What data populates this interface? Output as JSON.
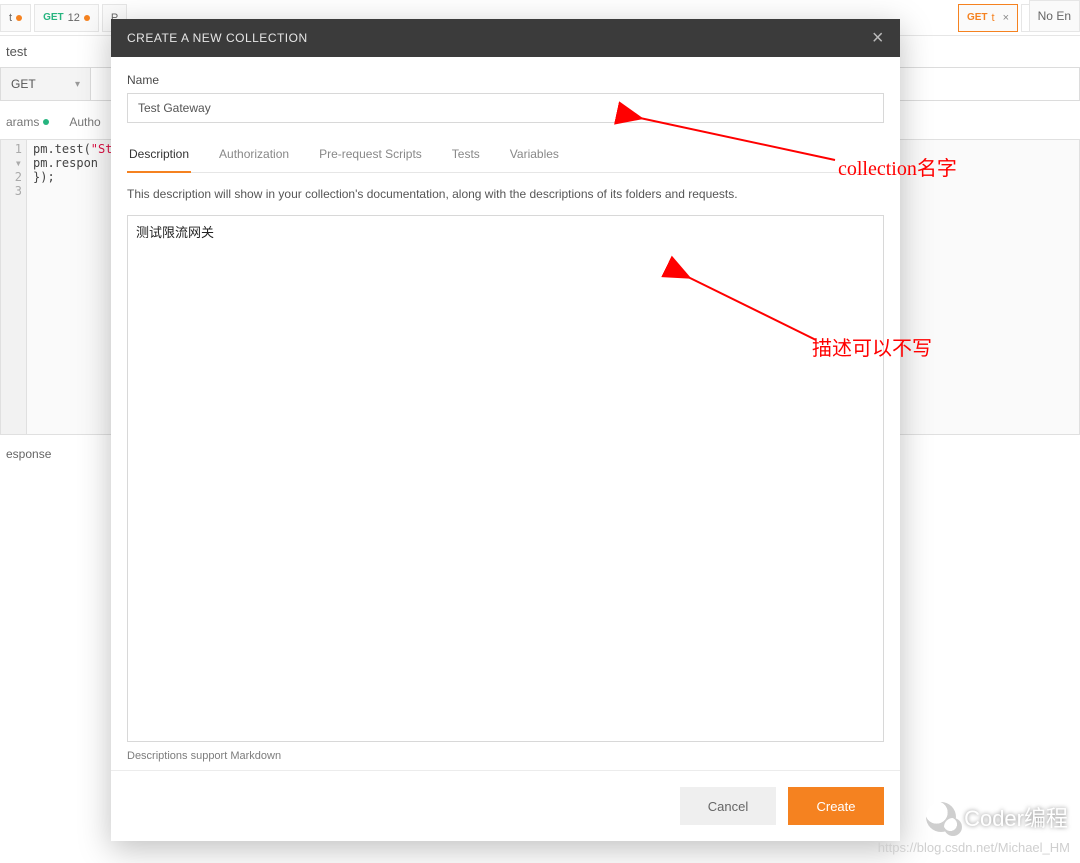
{
  "bg": {
    "tabs": [
      {
        "method": "",
        "label": "t",
        "dot": true
      },
      {
        "method": "GET",
        "label": "12",
        "dot": true
      },
      {
        "method": "",
        "label": "P",
        "dot": false
      }
    ],
    "active_tab": {
      "method": "GET",
      "label": "t"
    },
    "tab_close": "×",
    "plus": "+",
    "more": "•••",
    "no_env": "No En",
    "request_name": "test",
    "method": "GET",
    "chevron": "▾",
    "subtabs": {
      "params": "arams",
      "auth": "Autho"
    },
    "code": {
      "gutter": [
        "1 ▾",
        "2",
        "3"
      ],
      "line1a": "pm.test(",
      "line1b": "\"Stat",
      "line2": "    pm.respon",
      "line3": "});"
    },
    "response_label": "esponse"
  },
  "modal": {
    "title": "CREATE A NEW COLLECTION",
    "close": "×",
    "name_label": "Name",
    "name_value": "Test Gateway",
    "tabs": {
      "description": "Description",
      "authorization": "Authorization",
      "prerequest": "Pre-request Scripts",
      "tests": "Tests",
      "variables": "Variables"
    },
    "desc_hint": "This description will show in your collection's documentation, along with the descriptions of its folders and requests.",
    "desc_value": "测试限流网关",
    "md_hint": "Descriptions support Markdown",
    "cancel": "Cancel",
    "create": "Create"
  },
  "annotations": {
    "name": "collection名字",
    "desc": "描述可以不写"
  },
  "watermark": {
    "brand": "Coder编程",
    "url": "https://blog.csdn.net/Michael_HM"
  }
}
